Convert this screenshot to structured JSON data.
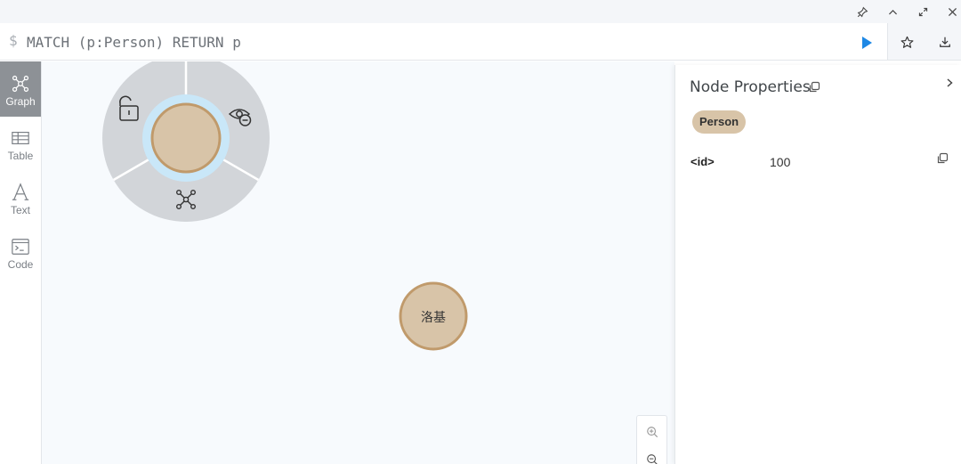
{
  "editor": {
    "prompt": "$",
    "query": "MATCH (p:Person) RETURN p"
  },
  "sidebar": {
    "items": [
      {
        "label": "Graph",
        "icon": "graph-icon",
        "active": true
      },
      {
        "label": "Table",
        "icon": "table-icon",
        "active": false
      },
      {
        "label": "Text",
        "icon": "text-icon",
        "active": false
      },
      {
        "label": "Code",
        "icon": "code-icon",
        "active": false
      }
    ]
  },
  "graph": {
    "nodes": [
      {
        "label": "",
        "selected": true
      },
      {
        "label": "洛基",
        "selected": false
      }
    ],
    "ring_menu": [
      "unlock-icon",
      "hide-icon",
      "expand-icon"
    ]
  },
  "panel": {
    "title": "Node Properties",
    "node_label": "Person",
    "properties": [
      {
        "key": "<id>",
        "value": "100"
      }
    ]
  },
  "colors": {
    "accent": "#1e88e5",
    "node_fill": "#d8c4a8",
    "node_stroke": "#c09a6b",
    "active_nav": "#8d9196"
  }
}
